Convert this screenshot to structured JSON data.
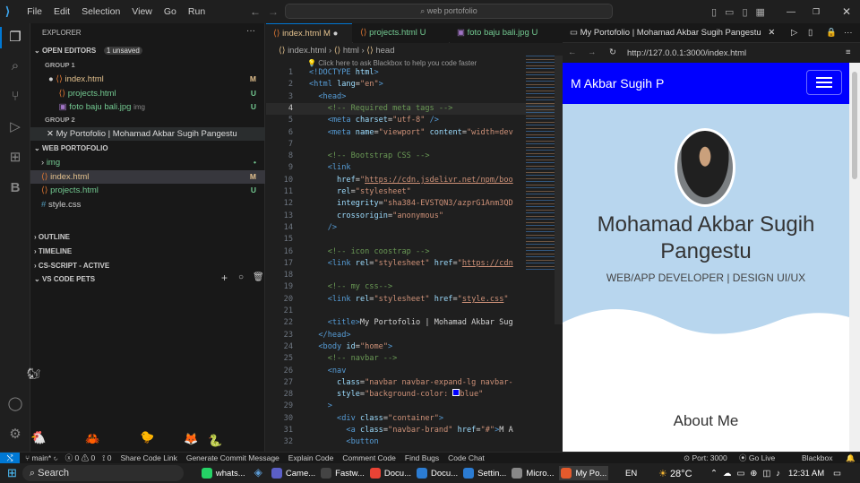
{
  "menu": [
    "File",
    "Edit",
    "Selection",
    "View",
    "Go",
    "Run"
  ],
  "command_center": "web portofolio",
  "explorer": {
    "title": "EXPLORER",
    "open_editors": "OPEN EDITORS",
    "unsaved": "1 unsaved",
    "group1": "GROUP 1",
    "group2": "GROUP 2",
    "g1_files": [
      {
        "name": "index.html",
        "badge": "M"
      },
      {
        "name": "projects.html",
        "badge": "U"
      },
      {
        "name": "foto baju bali.jpg",
        "hint": "img",
        "badge": "U"
      }
    ],
    "g2_files": [
      {
        "name": "My Portofolio | Mohamad Akbar Sugih Pangestu"
      }
    ],
    "project": "WEB PORTOFOLIO",
    "tree": [
      {
        "name": "img",
        "badge": "•"
      },
      {
        "name": "index.html",
        "badge": "M"
      },
      {
        "name": "projects.html",
        "badge": "U"
      },
      {
        "name": "style.css",
        "badge": ""
      }
    ],
    "sections": [
      "OUTLINE",
      "TIMELINE",
      "CS-SCRIPT - ACTIVE",
      "VS CODE PETS"
    ]
  },
  "tabs": [
    {
      "name": "index.html",
      "badge": "M"
    },
    {
      "name": "projects.html",
      "badge": "U"
    },
    {
      "name": "foto baju bali.jpg",
      "badge": "U"
    }
  ],
  "breadcrumb": [
    "index.html",
    "html",
    "head"
  ],
  "blackbox_hint": "Click here to ask Blackbox to help you code faster",
  "code_lines": [
    {
      "n": "1",
      "html": "<span class='t'>&lt;!DOCTYPE</span> <span class='a'>html</span><span class='t'>&gt;</span>"
    },
    {
      "n": "2",
      "html": "<span class='t'>&lt;html</span> <span class='a'>lang</span><span class='w'>=</span><span class='s'>\"en\"</span><span class='t'>&gt;</span>"
    },
    {
      "n": "3",
      "html": "  <span class='t'>&lt;head&gt;</span>"
    },
    {
      "n": "4",
      "html": "    <span class='c'>&lt;!-- Required meta tags --&gt;</span>"
    },
    {
      "n": "5",
      "html": "    <span class='t'>&lt;meta</span> <span class='a'>charset</span><span class='w'>=</span><span class='s'>\"utf-8\"</span> <span class='t'>/&gt;</span>"
    },
    {
      "n": "6",
      "html": "    <span class='t'>&lt;meta</span> <span class='a'>name</span><span class='w'>=</span><span class='s'>\"viewport\"</span> <span class='a'>content</span><span class='w'>=</span><span class='s'>\"width=dev</span>"
    },
    {
      "n": "7",
      "html": ""
    },
    {
      "n": "8",
      "html": "    <span class='c'>&lt;!-- Bootstrap CSS --&gt;</span>"
    },
    {
      "n": "9",
      "html": "    <span class='t'>&lt;link</span>"
    },
    {
      "n": "10",
      "html": "      <span class='a'>href</span><span class='w'>=</span><span class='s'>\"<u>https://cdn.jsdelivr.net/npm/boo</u></span>"
    },
    {
      "n": "11",
      "html": "      <span class='a'>rel</span><span class='w'>=</span><span class='s'>\"stylesheet\"</span>"
    },
    {
      "n": "12",
      "html": "      <span class='a'>integrity</span><span class='w'>=</span><span class='s'>\"sha384-EVSTQN3/azprG1Anm3QD</span>"
    },
    {
      "n": "13",
      "html": "      <span class='a'>crossorigin</span><span class='w'>=</span><span class='s'>\"anonymous\"</span>"
    },
    {
      "n": "14",
      "html": "    <span class='t'>/&gt;</span>"
    },
    {
      "n": "15",
      "html": ""
    },
    {
      "n": "16",
      "html": "    <span class='c'>&lt;!-- icon coostrap --&gt;</span>"
    },
    {
      "n": "17",
      "html": "    <span class='t'>&lt;link</span> <span class='a'>rel</span><span class='w'>=</span><span class='s'>\"stylesheet\"</span> <span class='a'>href</span><span class='w'>=</span><span class='s'>\"<u>https://cdn</u></span>"
    },
    {
      "n": "18",
      "html": ""
    },
    {
      "n": "19",
      "html": "    <span class='c'>&lt;!-- my css--&gt;</span>"
    },
    {
      "n": "20",
      "html": "    <span class='t'>&lt;link</span> <span class='a'>rel</span><span class='w'>=</span><span class='s'>\"stylesheet\"</span> <span class='a'>href</span><span class='w'>=</span><span class='s'>\"<u>style.css</u>\"</span>"
    },
    {
      "n": "21",
      "html": ""
    },
    {
      "n": "22",
      "html": "    <span class='t'>&lt;title&gt;</span><span class='w'>My Portofolio | Mohamad Akbar Sug</span>"
    },
    {
      "n": "23",
      "html": "  <span class='t'>&lt;/head&gt;</span>"
    },
    {
      "n": "24",
      "html": "  <span class='t'>&lt;body</span> <span class='a'>id</span><span class='w'>=</span><span class='s'>\"home\"</span><span class='t'>&gt;</span>"
    },
    {
      "n": "25",
      "html": "    <span class='c'>&lt;!-- navbar --&gt;</span>"
    },
    {
      "n": "26",
      "html": "    <span class='t'>&lt;nav</span>"
    },
    {
      "n": "27",
      "html": "      <span class='a'>class</span><span class='w'>=</span><span class='s'>\"navbar navbar-expand-lg navbar-</span>"
    },
    {
      "n": "28",
      "html": "      <span class='a'>style</span><span class='w'>=</span><span class='s'>\"background-color: <span style='display:inline-block;width:8px;height:8px;border:1px solid #fff;background:#00f'></span>blue\"</span>"
    },
    {
      "n": "29",
      "html": "    <span class='t'>&gt;</span>"
    },
    {
      "n": "30",
      "html": "      <span class='t'>&lt;div</span> <span class='a'>class</span><span class='w'>=</span><span class='s'>\"container\"</span><span class='t'>&gt;</span>"
    },
    {
      "n": "31",
      "html": "        <span class='t'>&lt;a</span> <span class='a'>class</span><span class='w'>=</span><span class='s'>\"navbar-brand\"</span> <span class='a'>href</span><span class='w'>=</span><span class='s'>\"#\"</span><span class='t'>&gt;</span><span class='w'>M A</span>"
    },
    {
      "n": "32",
      "html": "        <span class='t'>&lt;button</span>"
    }
  ],
  "browser": {
    "tab_title": "My Portofolio | Mohamad Akbar Sugih Pangestu",
    "url": "http://127.0.0.1:3000/index.html",
    "brand": "M Akbar Sugih P",
    "name_line1": "Mohamad Akbar Sugih",
    "name_line2": "Pangestu",
    "role": "WEB/APP DEVELOPER | DESIGN UI/UX",
    "about": "About Me",
    "nav_color": "#0000ff",
    "hero_color": "#b8d6ee"
  },
  "status": {
    "branch": "main*",
    "errors": "0",
    "warnings": "0",
    "ports": "0",
    "items": [
      "Share Code Link",
      "Generate Commit Message",
      "Explain Code",
      "Comment Code",
      "Find Bugs",
      "Code Chat"
    ],
    "port": "Port: 3000",
    "golive": "Go Live",
    "blackbox": "Blackbox"
  },
  "taskbar": {
    "search": "Search",
    "apps": [
      "whats...",
      "Came...",
      "Fastw...",
      "Docu...",
      "Docu...",
      "Settin...",
      "Micro...",
      "My Po..."
    ],
    "lang": "EN",
    "temp": "28°C",
    "time": "12:31 AM"
  }
}
